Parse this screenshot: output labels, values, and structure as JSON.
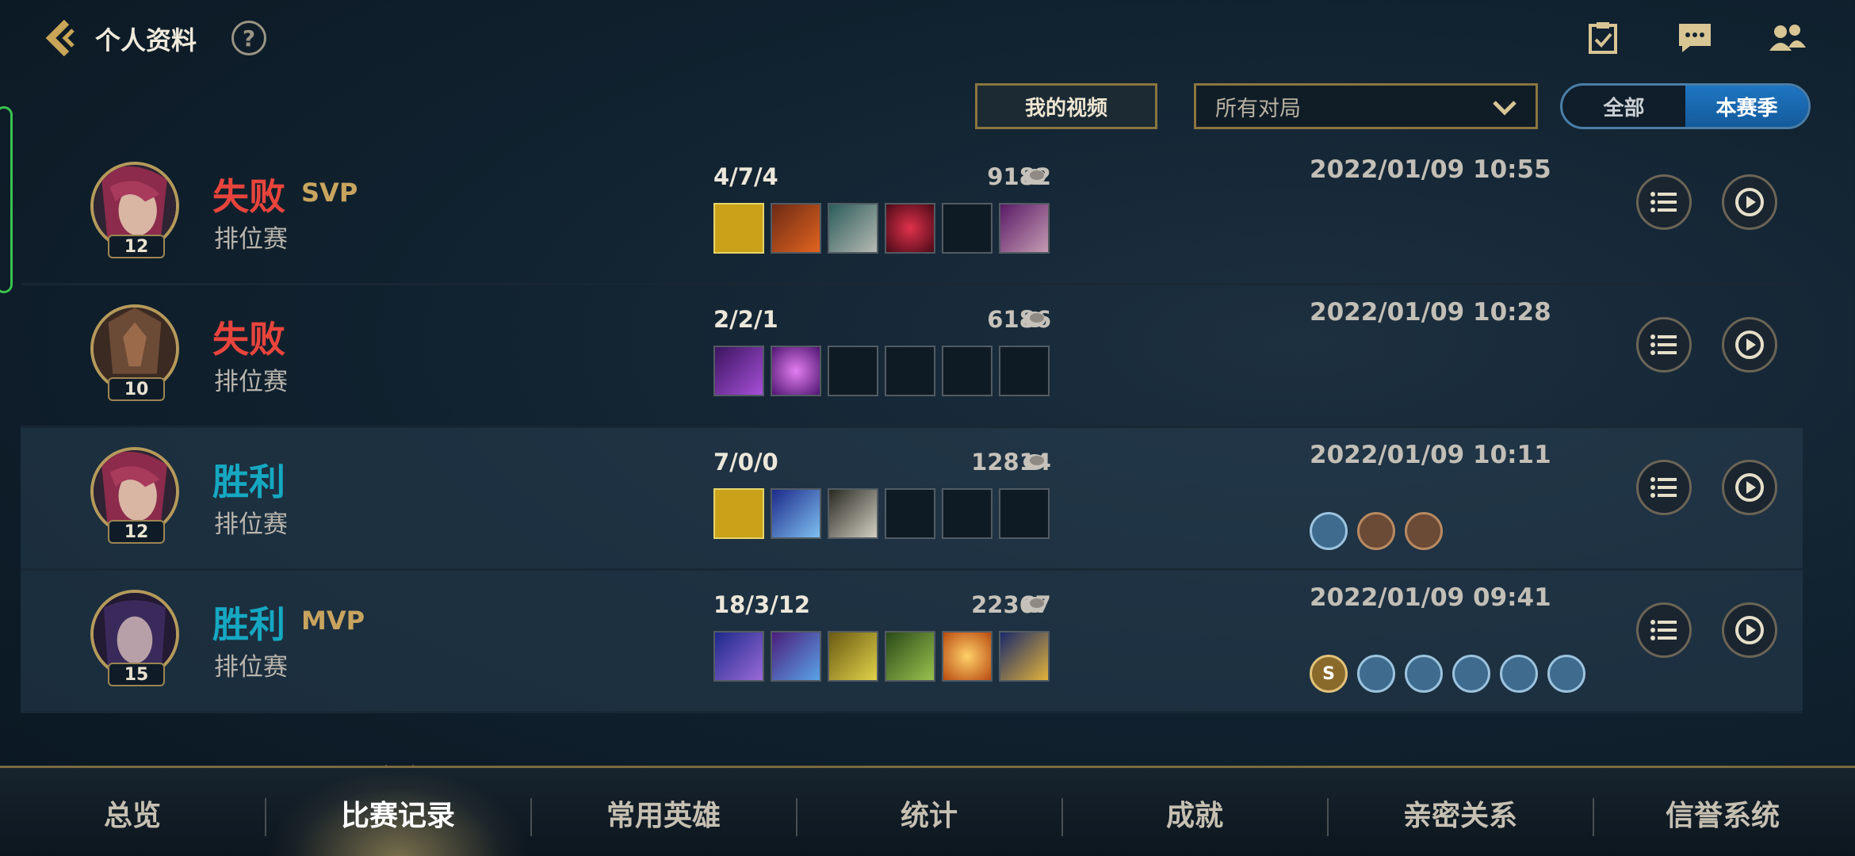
{
  "header": {
    "title": "个人资料",
    "help": "?"
  },
  "filters": {
    "my_videos": "我的视频",
    "match_filter": "所有对局",
    "segments": {
      "all": "全部",
      "season": "本赛季"
    }
  },
  "matches": [
    {
      "level": "12",
      "result": "失败",
      "badge": "SVP",
      "mode": "排位赛",
      "kda": "4/7/4",
      "gold": "9182",
      "date": "2022/01/09 10:55"
    },
    {
      "level": "10",
      "result": "失败",
      "badge": "",
      "mode": "排位赛",
      "kda": "2/2/1",
      "gold": "6186",
      "date": "2022/01/09 10:28"
    },
    {
      "level": "12",
      "result": "胜利",
      "badge": "",
      "mode": "排位赛",
      "kda": "7/0/0",
      "gold": "12814",
      "date": "2022/01/09 10:11"
    },
    {
      "level": "15",
      "result": "胜利",
      "badge": "MVP",
      "mode": "排位赛",
      "kda": "18/3/12",
      "gold": "22367",
      "date": "2022/01/09 09:41"
    }
  ],
  "tabs": [
    "总览",
    "比赛记录",
    "常用英雄",
    "统计",
    "成就",
    "亲密关系",
    "信誉系统"
  ],
  "active_tab": "比赛记录",
  "colors": {
    "lose": "#e8443c",
    "win": "#16a8c2",
    "gold_accent": "#c8a45e",
    "segment_active": "#1f76c3"
  }
}
